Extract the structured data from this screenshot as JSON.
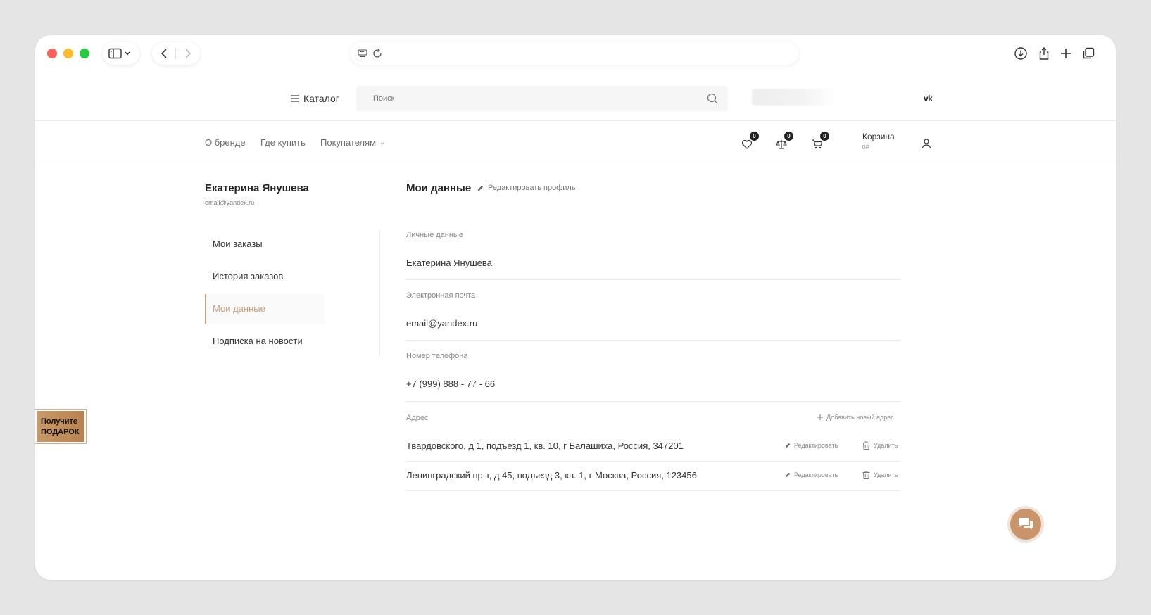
{
  "site": {
    "catalog_label": "Каталог",
    "search_placeholder": "Поиск",
    "vk_label": "vk"
  },
  "nav": {
    "links": [
      "О бренде",
      "Где купить",
      "Покупателям"
    ],
    "favorites_count": "0",
    "compare_count": "0",
    "cart_count": "0",
    "cart_label": "Корзина",
    "cart_price": "0₽"
  },
  "profile": {
    "name": "Екатерина Янушева",
    "email": "email@yandex.ru"
  },
  "sidebar": {
    "items": [
      {
        "label": "Мои заказы"
      },
      {
        "label": "История заказов"
      },
      {
        "label": "Мои данные",
        "active": true
      },
      {
        "label": "Подписка на новости"
      }
    ]
  },
  "main": {
    "title": "Мои данные",
    "edit_profile_label": "Редактировать профиль",
    "fields": [
      {
        "label": "Личные данные",
        "value": "Екатерина Янушева"
      },
      {
        "label": "Электронная почта",
        "value": "email@yandex.ru"
      },
      {
        "label": "Номер телефона",
        "value": "+7 (999) 888 - 77 - 66"
      }
    ],
    "address_label": "Адрес",
    "add_address_label": "Добавить новый адрес",
    "addresses": [
      {
        "text": "Твардовского, д 1, подъезд 1, кв. 10, г Балашиха, Россия, 347201",
        "edit": "Редактировать",
        "delete": "Удалить"
      },
      {
        "text": "Ленинградский пр-т, д 45, подъезд 3, кв. 1, г Москва, Россия, 123456",
        "edit": "Редактировать",
        "delete": "Удалить"
      }
    ]
  },
  "gift": {
    "line1": "Получите",
    "line2": "ПОДАРОК"
  },
  "colors": {
    "accent": "#c8a07a",
    "gift_bg": "#b8824f",
    "chat_bg": "#c9946a"
  }
}
